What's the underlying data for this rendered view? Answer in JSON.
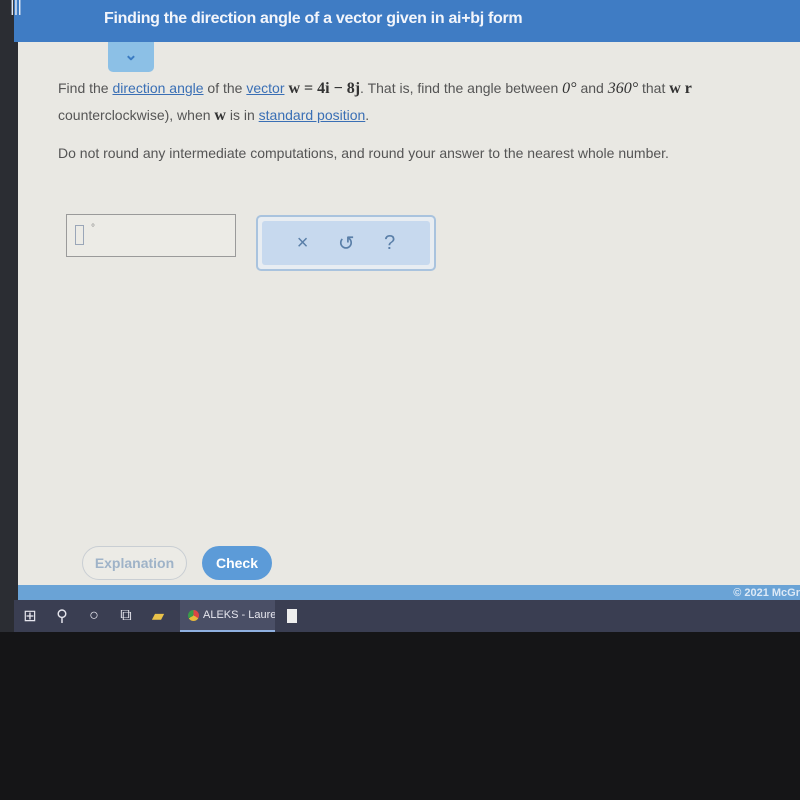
{
  "header": {
    "title": "Finding the direction angle of a vector given in ai+bj form",
    "menu_icon": "hamburger-icon"
  },
  "problem": {
    "l1_a": "Find the ",
    "l1_link1": "direction angle",
    "l1_b": " of the ",
    "l1_link2": "vector",
    "l1_math": " w = 4i − 8j",
    "l1_c": ". That is, find the angle between ",
    "l1_math2": "0°",
    "l1_d": " and ",
    "l1_math3": "360°",
    "l1_e": " that ",
    "l1_math4": "w r",
    "l2_a": "counterclockwise), when ",
    "l2_math": "w",
    "l2_b": " is in ",
    "l2_link": "standard position",
    "l2_c": ".",
    "l3": "Do not round any intermediate computations, and round your answer to the nearest whole number."
  },
  "answer": {
    "value": "",
    "unit": "°"
  },
  "tools": {
    "clear": "×",
    "undo": "↺",
    "help": "?"
  },
  "buttons": {
    "explanation": "Explanation",
    "check": "Check"
  },
  "footer": {
    "copyright": "© 2021 McGr"
  },
  "taskbar": {
    "chrome_label": "ALEKS - Lauren Owsle..."
  }
}
